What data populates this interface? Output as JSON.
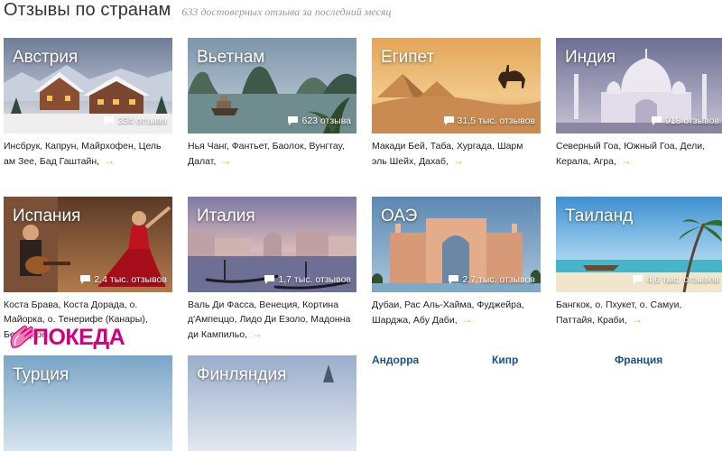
{
  "header": {
    "title": "Отзывы по странам",
    "subtitle": "633 достоверных отзыва за последний месяц"
  },
  "cards": [
    {
      "country": "Австрия",
      "count": "334 отзыва",
      "cities": [
        "Инсбрук,",
        "Капрун,",
        "Майрхофен,",
        "Цель ам Зее,",
        "Бад Гаштайн,"
      ],
      "arrow": "→"
    },
    {
      "country": "Вьетнам",
      "count": "623 отзыва",
      "cities": [
        "Нья Чанг,",
        "Фантьет,",
        "Баолок,",
        "Вунгтау,",
        "Далат,"
      ],
      "arrow": "→"
    },
    {
      "country": "Египет",
      "count": "31,5 тыс. отзывов",
      "cities": [
        "Макади Бей,",
        "Таба,",
        "Хургада,",
        "Шарм эль Шейх,",
        "Дахаб,"
      ],
      "arrow": "→"
    },
    {
      "country": "Индия",
      "count": "918 отзывов",
      "cities": [
        "Северный Гоа,",
        "Южный Гоа,",
        "Дели,",
        "Керала,",
        "Агра,"
      ],
      "arrow": "→"
    },
    {
      "country": "Испания",
      "count": "2,4 тыс. отзывов",
      "cities": [
        "Коста Брава,",
        "Коста Дорада,",
        "о. Майорка,",
        "о. Тенерифе (Канары),",
        "Бенидорм,"
      ],
      "arrow": "→"
    },
    {
      "country": "Италия",
      "count": "1,7 тыс. отзывов",
      "cities": [
        "Валь Ди Фасса,",
        "Венеция,",
        "Кортина д'Ампеццо,",
        "Лидо Ди Езоло,",
        "Мадонна ди Кампильо,"
      ],
      "arrow": "→"
    },
    {
      "country": "ОАЭ",
      "count": "2,7 тыс. отзывов",
      "cities": [
        "Дубаи,",
        "Рас Аль-Хайма,",
        "Фуджейра,",
        "Шарджа,",
        "Абу Даби,"
      ],
      "arrow": "→"
    },
    {
      "country": "Таиланд",
      "count": "4,6 тыс. отзывов",
      "cities": [
        "Бангкок,",
        "о. Пхукет,",
        "о. Самуи,",
        "Паттайя,",
        "Краби,"
      ],
      "arrow": "→"
    },
    {
      "country": "Турция",
      "count": "",
      "cities": [],
      "arrow": ""
    },
    {
      "country": "Финляндия",
      "count": "",
      "cities": [],
      "arrow": ""
    }
  ],
  "more_countries": [
    "Андорра",
    "Кипр",
    "Франция"
  ],
  "watermark": {
    "text": "ПОКЕДА",
    "color": "#d1007d"
  },
  "icons": {
    "count": "speech-bubble-icon",
    "more": "arrow-right-icon"
  }
}
